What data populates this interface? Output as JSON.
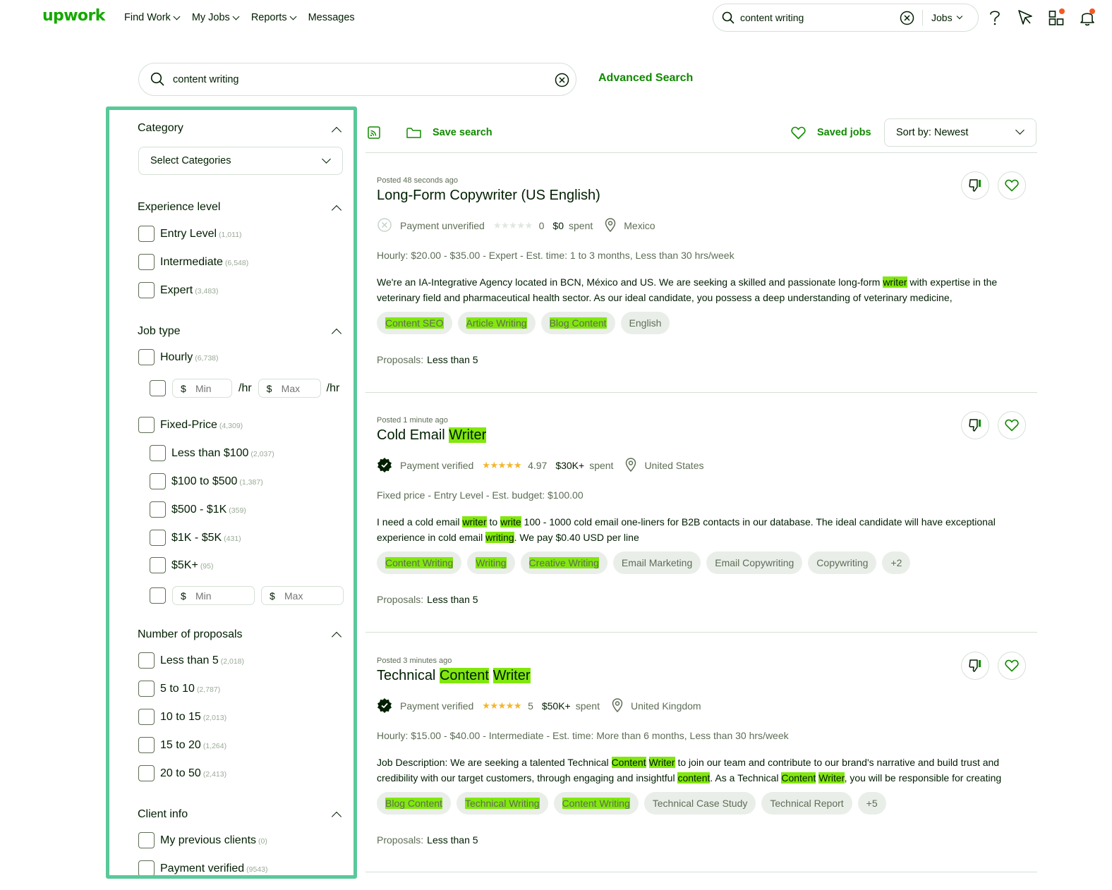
{
  "nav": {
    "logo": "upwork",
    "items": [
      {
        "label": "Find Work",
        "has_menu": true
      },
      {
        "label": "My Jobs",
        "has_menu": true
      },
      {
        "label": "Reports",
        "has_menu": true
      },
      {
        "label": "Messages",
        "has_menu": false
      }
    ],
    "search_value": "content writing",
    "search_scope": "Jobs",
    "icons": [
      "help-icon",
      "direct-contracts-icon",
      "apps-icon",
      "notifications-icon"
    ]
  },
  "search": {
    "value": "content writing",
    "advanced_label": "Advanced Search"
  },
  "filters": {
    "category": {
      "title": "Category",
      "placeholder": "Select Categories"
    },
    "experience": {
      "title": "Experience level",
      "options": [
        {
          "label": "Entry Level",
          "count": "(1,011)"
        },
        {
          "label": "Intermediate",
          "count": "(6,548)"
        },
        {
          "label": "Expert",
          "count": "(3,483)"
        }
      ]
    },
    "job_type": {
      "title": "Job type",
      "hourly": {
        "label": "Hourly",
        "count": "(6,738)"
      },
      "rate_min_placeholder": "Min",
      "rate_max_placeholder": "Max",
      "currency": "$",
      "rate_unit": "/hr",
      "fixed": {
        "label": "Fixed-Price",
        "count": "(4,309)"
      },
      "fixed_options": [
        {
          "label": "Less than $100",
          "count": "(2,037)"
        },
        {
          "label": "$100 to $500",
          "count": "(1,387)"
        },
        {
          "label": "$500 - $1K",
          "count": "(359)"
        },
        {
          "label": "$1K - $5K",
          "count": "(431)"
        },
        {
          "label": "$5K+",
          "count": "(95)"
        }
      ],
      "fixed_min_placeholder": "Min",
      "fixed_max_placeholder": "Max"
    },
    "proposals": {
      "title": "Number of proposals",
      "options": [
        {
          "label": "Less than 5",
          "count": "(2,018)"
        },
        {
          "label": "5 to 10",
          "count": "(2,787)"
        },
        {
          "label": "10 to 15",
          "count": "(2,013)"
        },
        {
          "label": "15 to 20",
          "count": "(1,264)"
        },
        {
          "label": "20 to 50",
          "count": "(2,413)"
        }
      ]
    },
    "client_info": {
      "title": "Client info",
      "options": [
        {
          "label": "My previous clients",
          "count": "(0)"
        },
        {
          "label": "Payment verified",
          "count": "(9543)"
        }
      ]
    }
  },
  "toolbar": {
    "save_search": "Save search",
    "saved_jobs": "Saved jobs",
    "sort": "Sort by: Newest"
  },
  "jobs": [
    {
      "posted": "Posted 48 seconds ago",
      "title": [
        {
          "t": "Long-Form Copywriter (US English)",
          "h": false
        }
      ],
      "payment": "Payment unverified",
      "verified": false,
      "rating": "0",
      "stars_filled": 0,
      "spent": "$0",
      "spent_label": "spent",
      "location": "Mexico",
      "info": "Hourly: $20.00 - $35.00 - Expert - Est. time: 1 to 3 months, Less than 30 hrs/week",
      "description": [
        {
          "t": "We're an IA-Integrative Agency located in BCN, México and US. We are seeking a skilled and passionate long-form ",
          "h": false
        },
        {
          "t": "writer",
          "h": true
        },
        {
          "t": " with expertise in the veterinary field and pharmaceutical health sector. As our ideal candidate, you possess a deep understanding of veterinary medicine, pharmacology,...",
          "h": false
        }
      ],
      "tags": [
        {
          "label": "Content SEO",
          "h": true
        },
        {
          "label": "Article Writing",
          "h": true
        },
        {
          "label": "Blog Content",
          "h": true
        },
        {
          "label": "English",
          "h": false
        }
      ],
      "proposals_label": "Proposals:",
      "proposals": "Less than 5"
    },
    {
      "posted": "Posted 1 minute ago",
      "title": [
        {
          "t": "Cold Email ",
          "h": false
        },
        {
          "t": "Writer",
          "h": true
        }
      ],
      "payment": "Payment verified",
      "verified": true,
      "rating": "4.97",
      "stars_filled": 5,
      "spent": "$30K+",
      "spent_label": "spent",
      "location": "United States",
      "info": "Fixed price - Entry Level - Est. budget: $100.00",
      "description": [
        {
          "t": "I need a cold email ",
          "h": false
        },
        {
          "t": "writer",
          "h": true
        },
        {
          "t": " to ",
          "h": false
        },
        {
          "t": "write",
          "h": true
        },
        {
          "t": " 100 - 1000 cold email one-liners for B2B contacts in our database. The ideal candidate will have exceptional experience in cold email ",
          "h": false
        },
        {
          "t": "writing",
          "h": true
        },
        {
          "t": ". We pay $0.40 USD per line",
          "h": false
        }
      ],
      "tags": [
        {
          "label": "Content Writing",
          "h": true
        },
        {
          "label": "Writing",
          "h": true
        },
        {
          "label": "Creative Writing",
          "h": true
        },
        {
          "label": "Email Marketing",
          "h": false
        },
        {
          "label": "Email Copywriting",
          "h": false
        },
        {
          "label": "Copywriting",
          "h": false
        },
        {
          "label": "+2",
          "h": false
        }
      ],
      "proposals_label": "Proposals:",
      "proposals": "Less than 5"
    },
    {
      "posted": "Posted 3 minutes ago",
      "title": [
        {
          "t": "Technical ",
          "h": false
        },
        {
          "t": "Content",
          "h": true
        },
        {
          "t": " ",
          "h": false
        },
        {
          "t": "Writer",
          "h": true
        }
      ],
      "payment": "Payment verified",
      "verified": true,
      "rating": "5",
      "stars_filled": 5,
      "spent": "$50K+",
      "spent_label": "spent",
      "location": "United Kingdom",
      "info": "Hourly: $15.00 - $40.00 - Intermediate - Est. time: More than 6 months, Less than 30 hrs/week",
      "description": [
        {
          "t": "Job Description: We are seeking a talented Technical ",
          "h": false
        },
        {
          "t": "Content",
          "h": true
        },
        {
          "t": " ",
          "h": false
        },
        {
          "t": "Writer",
          "h": true
        },
        {
          "t": " to join our team and contribute to our brand's narrative and build trust and credibility with our target customers, through engaging and insightful ",
          "h": false
        },
        {
          "t": "content",
          "h": true
        },
        {
          "t": ". As a Technical ",
          "h": false
        },
        {
          "t": "Content",
          "h": true
        },
        {
          "t": " ",
          "h": false
        },
        {
          "t": "Writer",
          "h": true
        },
        {
          "t": ", you will be responsible for creating high...",
          "h": false
        }
      ],
      "tags": [
        {
          "label": "Blog Content",
          "h": true
        },
        {
          "label": "Technical Writing",
          "h": true
        },
        {
          "label": "Content Writing",
          "h": true
        },
        {
          "label": "Technical Case Study",
          "h": false
        },
        {
          "label": "Technical Report",
          "h": false
        },
        {
          "label": "+5",
          "h": false
        }
      ],
      "proposals_label": "Proposals:",
      "proposals": "Less than 5"
    }
  ],
  "colors": {
    "brand": "#14a800",
    "link": "#108a00",
    "highlight": "#82e70f",
    "sidebar_outline": "#5ac89a",
    "star": "#f1b62c",
    "notification": "#f25a24"
  }
}
